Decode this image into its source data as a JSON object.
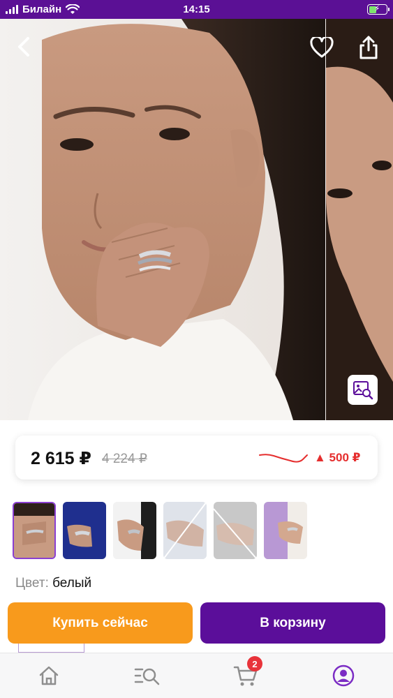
{
  "status_bar": {
    "carrier": "Билайн",
    "time": "14:15"
  },
  "product": {
    "price_current": "2 615 ₽",
    "price_old": "4 224 ₽",
    "price_change": "▲ 500 ₽",
    "color_label": "Цвет:",
    "color_value": "белый"
  },
  "actions": {
    "buy_now_label": "Купить сейчас",
    "add_to_cart_label": "В корзину"
  },
  "nav": {
    "cart_badge_count": "2",
    "items": [
      "home-icon",
      "catalog-search-icon",
      "cart-icon",
      "profile-icon"
    ]
  },
  "colors": {
    "brand_purple": "#5b0e9a",
    "buy_orange": "#f89a1c",
    "price_up_red": "#e52e2e"
  }
}
